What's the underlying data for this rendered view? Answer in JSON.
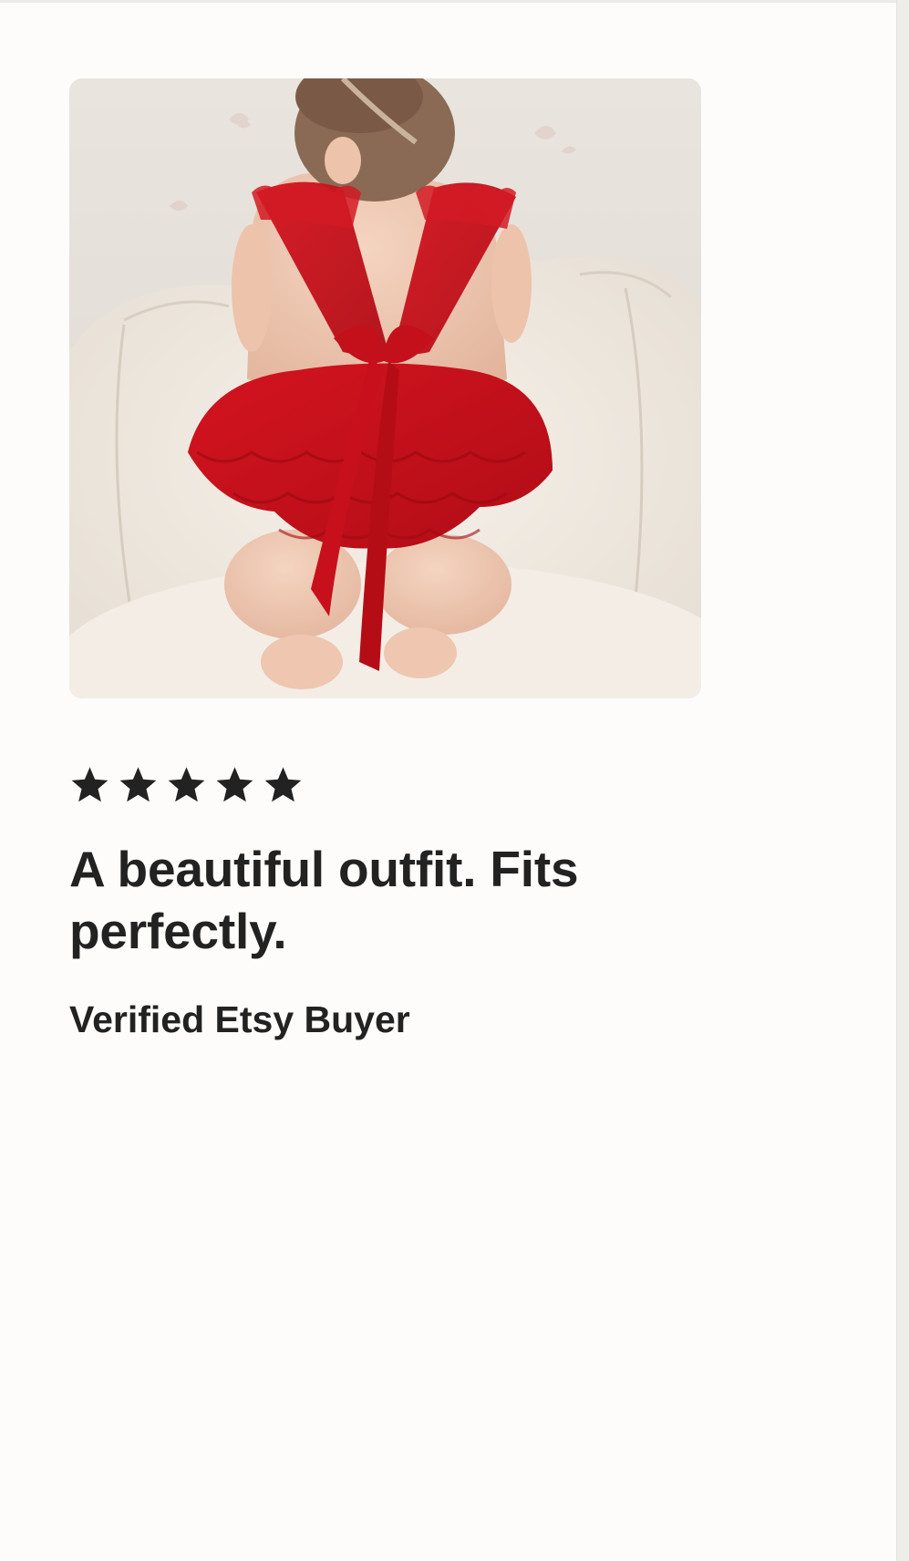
{
  "review": {
    "photo_alt": "Review photo of the purchased item",
    "rating": 5,
    "rating_max": 5,
    "headline": "A beautiful outfit. Fits perfectly.",
    "reviewer": "Verified Etsy Buyer"
  },
  "colors": {
    "text": "#222222",
    "background": "#fdfcfb",
    "star": "#222222",
    "dress_red": "#c8101c"
  },
  "icons": {
    "rating": "star-icon"
  }
}
